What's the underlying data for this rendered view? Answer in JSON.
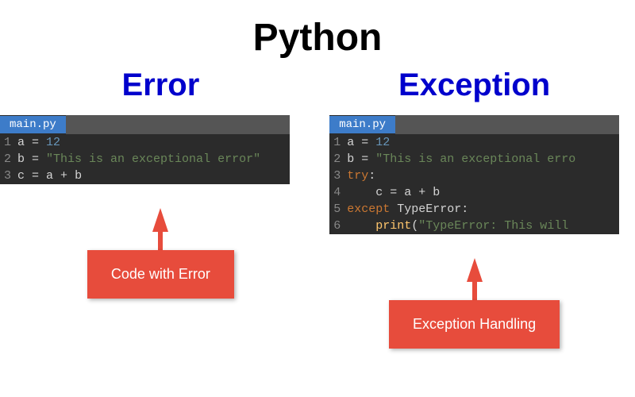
{
  "title": "Python",
  "left": {
    "heading": "Error",
    "filename": "main.py",
    "lines": [
      {
        "n": "1",
        "tokens": [
          {
            "t": "a",
            "c": "var"
          },
          {
            "t": " = ",
            "c": "op"
          },
          {
            "t": "12",
            "c": "num"
          }
        ]
      },
      {
        "n": "2",
        "tokens": [
          {
            "t": "b",
            "c": "var"
          },
          {
            "t": " = ",
            "c": "op"
          },
          {
            "t": "\"This is an exceptional error\"",
            "c": "str"
          }
        ]
      },
      {
        "n": "3",
        "tokens": [
          {
            "t": "c",
            "c": "var"
          },
          {
            "t": " = ",
            "c": "op"
          },
          {
            "t": "a",
            "c": "var"
          },
          {
            "t": " + ",
            "c": "op"
          },
          {
            "t": "b",
            "c": "var"
          }
        ]
      }
    ],
    "callout": "Code with Error"
  },
  "right": {
    "heading": "Exception",
    "filename": "main.py",
    "lines": [
      {
        "n": "1",
        "tokens": [
          {
            "t": "a",
            "c": "var"
          },
          {
            "t": " = ",
            "c": "op"
          },
          {
            "t": "12",
            "c": "num"
          }
        ]
      },
      {
        "n": "2",
        "tokens": [
          {
            "t": "b",
            "c": "var"
          },
          {
            "t": " = ",
            "c": "op"
          },
          {
            "t": "\"This is an exceptional erro",
            "c": "str"
          }
        ]
      },
      {
        "n": "3",
        "tokens": [
          {
            "t": "try",
            "c": "kw"
          },
          {
            "t": ":",
            "c": "op"
          }
        ]
      },
      {
        "n": "4",
        "tokens": [
          {
            "t": "    c",
            "c": "var"
          },
          {
            "t": " = ",
            "c": "op"
          },
          {
            "t": "a",
            "c": "var"
          },
          {
            "t": " + ",
            "c": "op"
          },
          {
            "t": "b",
            "c": "var"
          }
        ]
      },
      {
        "n": "5",
        "tokens": [
          {
            "t": "except ",
            "c": "kw"
          },
          {
            "t": "TypeError",
            "c": "typ"
          },
          {
            "t": ":",
            "c": "op"
          }
        ]
      },
      {
        "n": "6",
        "tokens": [
          {
            "t": "    ",
            "c": "var"
          },
          {
            "t": "print",
            "c": "fn"
          },
          {
            "t": "(",
            "c": "op"
          },
          {
            "t": "\"TypeError: This will ",
            "c": "str"
          }
        ]
      }
    ],
    "callout": "Exception Handling"
  }
}
